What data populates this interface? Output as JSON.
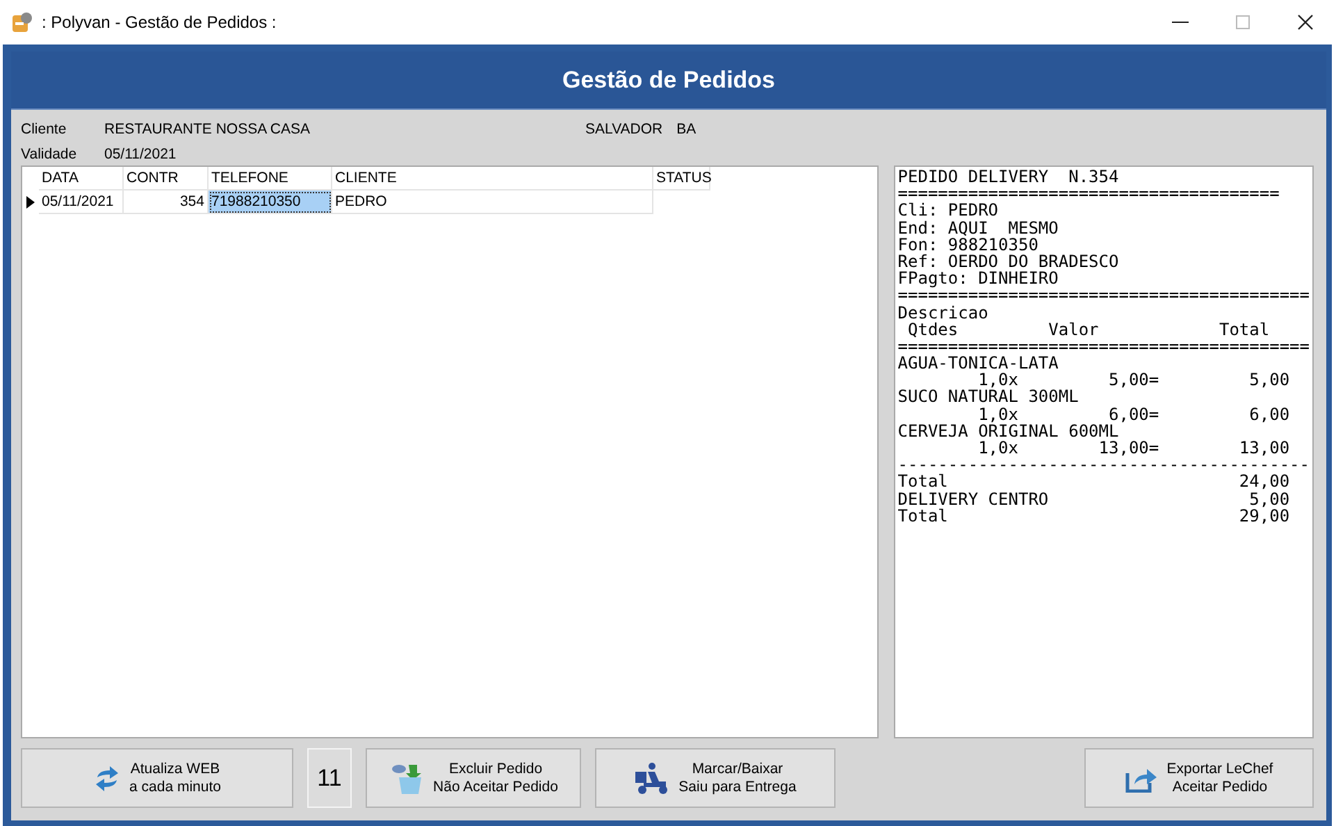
{
  "window": {
    "title": ": Polyvan - Gestão de Pedidos :"
  },
  "header": {
    "title": "Gestão de Pedidos"
  },
  "info": {
    "client_label": "Cliente",
    "client": "RESTAURANTE NOSSA CASA",
    "city": "SALVADOR",
    "state": "BA",
    "validity_label": "Validade",
    "validity": "05/11/2021"
  },
  "table": {
    "columns": [
      "DATA",
      "CONTR",
      "TELEFONE",
      "CLIENTE",
      "STATUS"
    ],
    "rows": [
      {
        "selected": true,
        "cells": [
          {
            "text": "05/11/2021",
            "selected": false
          },
          {
            "text": "354",
            "selected": false
          },
          {
            "text": "71988210350",
            "selected": true
          },
          {
            "text": "PEDRO",
            "selected": false
          }
        ]
      }
    ]
  },
  "receipt": {
    "lines": [
      "PEDIDO DELIVERY  N.354",
      "======================================",
      "Cli: PEDRO",
      "End: AQUI  MESMO",
      "Fon: 988210350",
      "Ref: OERDO DO BRADESCO",
      "FPagto: DINHEIRO",
      "=========================================",
      "Descricao",
      " Qtdes         Valor            Total",
      "=========================================",
      "AGUA-TONICA-LATA",
      "        1,0x         5,00=         5,00",
      "SUCO NATURAL 300ML",
      "        1,0x         6,00=         6,00",
      "CERVEJA ORIGINAL 600ML",
      "        1,0x        13,00=        13,00",
      "-----------------------------------------",
      "Total                             24,00",
      "DELIVERY CENTRO                    5,00",
      "Total                             29,00"
    ]
  },
  "buttons": [
    {
      "kind": "refresh",
      "lines": [
        "Atualiza WEB",
        "a cada minuto"
      ]
    },
    {
      "kind": "counter",
      "lines": [
        "11"
      ]
    },
    {
      "kind": "delete",
      "lines": [
        "Excluir Pedido",
        "Não Aceitar Pedido"
      ]
    },
    {
      "kind": "delivery",
      "lines": [
        "Marcar/Baixar",
        "Saiu para Entrega"
      ]
    },
    {
      "kind": "export",
      "lines": [
        "Exportar LeChef",
        "Aceitar Pedido"
      ]
    }
  ]
}
